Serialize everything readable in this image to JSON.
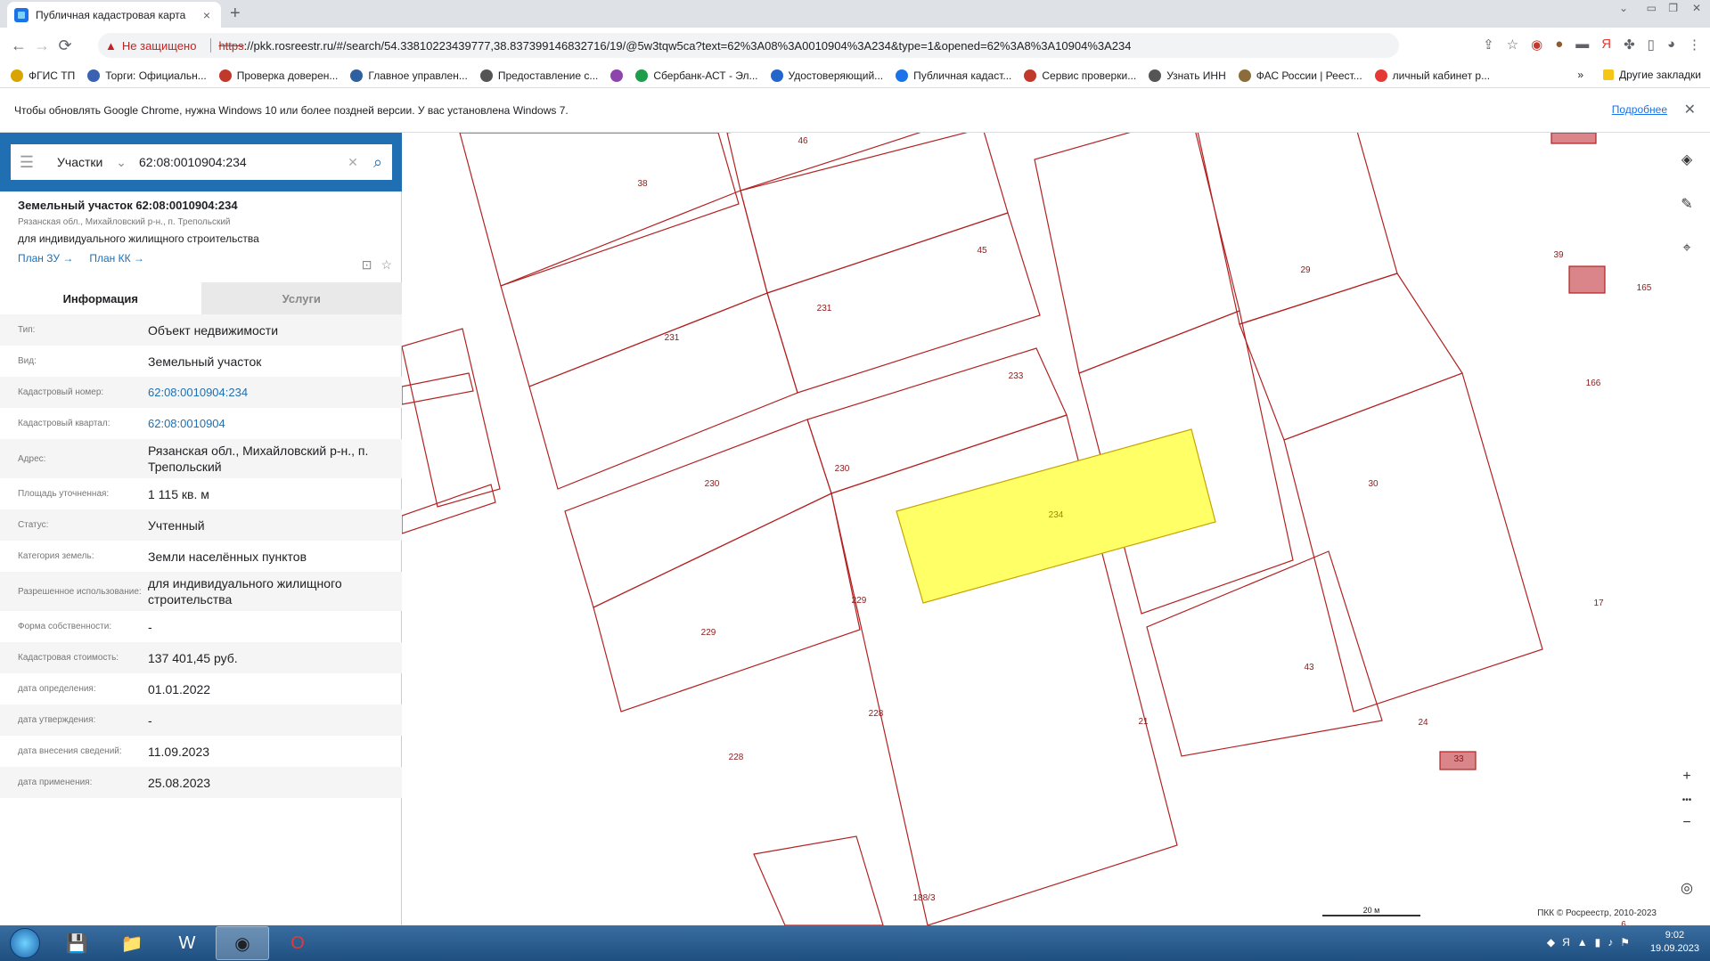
{
  "browser": {
    "tab_title": "Публичная кадастровая карта",
    "tab_close": "×",
    "new_tab": "+",
    "not_secure": "Не защищено",
    "url_scheme": "https",
    "url_rest": "://pkk.rosreestr.ru/#/search/54.33810223439777,38.837399146832716/19/@5w3tqw5ca?text=62%3A08%3A0010904%3A234&type=1&opened=62%3A8%3A10904%3A234"
  },
  "bookmarks": [
    {
      "label": "ФГИС ТП",
      "color": "#d9a400"
    },
    {
      "label": "Торги: Официальн...",
      "color": "#3a62b0"
    },
    {
      "label": "Проверка доверен...",
      "color": "#c0392b"
    },
    {
      "label": "Главное управлен...",
      "color": "#2e5f9e"
    },
    {
      "label": "Предоставление с...",
      "color": "#555555"
    },
    {
      "label": "",
      "color": "#8e44ad"
    },
    {
      "label": "Сбербанк-АСТ - Эл...",
      "color": "#1e9e4a"
    },
    {
      "label": "Удостоверяющий...",
      "color": "#2266cc"
    },
    {
      "label": "Публичная кадаст...",
      "color": "#1a73e8"
    },
    {
      "label": "Сервис проверки...",
      "color": "#c0392b"
    },
    {
      "label": "Узнать ИНН",
      "color": "#555555"
    },
    {
      "label": "ФАС России | Реест...",
      "color": "#8a6d3b"
    },
    {
      "label": "личный кабинет р...",
      "color": "#e53935"
    }
  ],
  "bookmarks_more": "»",
  "other_bookmarks": "Другие закладки",
  "infobar": {
    "text": "Чтобы обновлять Google Chrome, нужна Windows 10 или более поздней версии. У вас установлена Windows 7.",
    "link": "Подробнее",
    "close": "✕"
  },
  "search": {
    "type": "Участки",
    "value": "62:08:0010904:234"
  },
  "object": {
    "title": "Земельный участок 62:08:0010904:234",
    "address": "Рязанская обл., Михайловский р-н., п. Трепольский",
    "use": "для индивидуального жилищного строительства",
    "link_plan_zu": "План ЗУ →",
    "link_plan_kk": "План КК →"
  },
  "tabs": {
    "info": "Информация",
    "services": "Услуги"
  },
  "rows": [
    {
      "k": "Тип:",
      "v": "Объект недвижимости",
      "link": false
    },
    {
      "k": "Вид:",
      "v": "Земельный участок",
      "link": false
    },
    {
      "k": "Кадастровый номер:",
      "v": "62:08:0010904:234",
      "link": true
    },
    {
      "k": "Кадастровый квартал:",
      "v": "62:08:0010904",
      "link": true
    },
    {
      "k": "Адрес:",
      "v": "Рязанская обл., Михайловский р-н., п. Трепольский",
      "link": false
    },
    {
      "k": "Площадь уточненная:",
      "v": "1 115 кв. м",
      "link": false
    },
    {
      "k": "Статус:",
      "v": "Учтенный",
      "link": false
    },
    {
      "k": "Категория земель:",
      "v": "Земли населённых пунктов",
      "link": false
    },
    {
      "k": "Разрешенное использование:",
      "v": "для индивидуального жилищного строительства",
      "link": false
    },
    {
      "k": "Форма собственности:",
      "v": "-",
      "link": false
    },
    {
      "k": "Кадастровая стоимость:",
      "v": "137 401,45 руб.",
      "link": false
    },
    {
      "k": "дата определения:",
      "v": "01.01.2022",
      "link": false
    },
    {
      "k": "дата утверждения:",
      "v": "-",
      "link": false
    },
    {
      "k": "дата внесения сведений:",
      "v": "11.09.2023",
      "link": false
    },
    {
      "k": "дата применения:",
      "v": "25.08.2023",
      "link": false
    }
  ],
  "map": {
    "parcel_line_color": "#b22222",
    "selected_fill": "#ffff66",
    "labels": [
      "38",
      "46",
      "45",
      "29",
      "39",
      "165",
      "231",
      "231",
      "233",
      "166",
      "230",
      "230",
      "234",
      "30",
      "229",
      "229",
      "17",
      "43",
      "228",
      "228",
      "21",
      "24",
      "33",
      "188/3",
      "6"
    ],
    "scale": "20 м",
    "copyright": "ПКК © Росреестр, 2010-2023",
    "zoom_in": "+",
    "zoom_more": "•••",
    "zoom_out": "−"
  },
  "taskbar": {
    "time": "9:02",
    "date": "19.09.2023"
  }
}
